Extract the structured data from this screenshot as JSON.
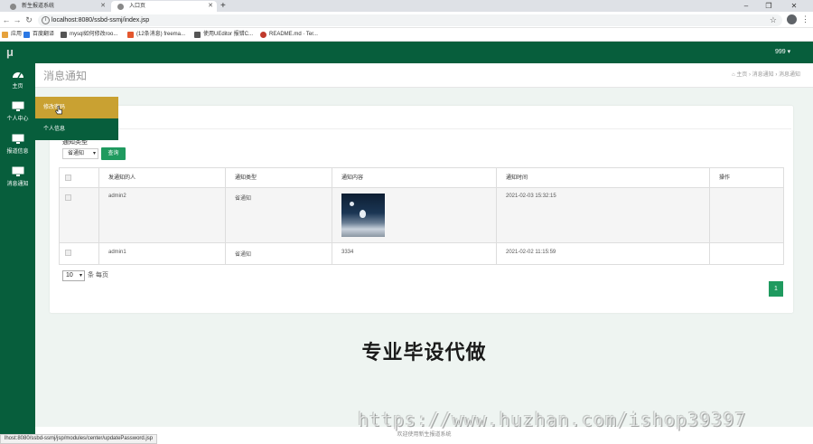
{
  "browser": {
    "tabs": [
      {
        "title": "新生报道系统"
      },
      {
        "title": "入口页"
      }
    ],
    "url": "localhost:8080/ssbd-ssmj/index.jsp",
    "bookmarks": [
      "应用",
      "百度翻译",
      "mysql如何修改roo...",
      "(12条消息) freema...",
      "使用UEditor 报错C...",
      "README.md · Ter..."
    ],
    "status_url": "lhost:8080/ssbd-ssmj/jsp/modules/center/updatePassword.jsp"
  },
  "header": {
    "logo": "μ",
    "user": "999 ▾"
  },
  "sidebar": {
    "items": [
      {
        "label": "主页",
        "icon": "dashboard-icon"
      },
      {
        "label": "个人中心",
        "icon": "monitor-icon"
      },
      {
        "label": "报道信息",
        "icon": "monitor-icon"
      },
      {
        "label": "消息通知",
        "icon": "monitor-icon"
      }
    ],
    "submenu": [
      "修改密码",
      "个人信息"
    ],
    "colors": {
      "bg": "#075e3c",
      "submenu_active": "#c9a132",
      "submenu": "#075e3c"
    }
  },
  "page": {
    "title": "消息通知",
    "breadcrumb": [
      "主页",
      "消息通知",
      "消息通知"
    ]
  },
  "filter": {
    "label": "通知类型",
    "selected": "省通知",
    "button": "查询"
  },
  "table": {
    "headers": [
      "发通知的人",
      "通知类型",
      "通知内容",
      "通知时间",
      "操作"
    ],
    "rows": [
      {
        "sender": "admin2",
        "type": "省通知",
        "content": "[image]",
        "time": "2021-02-03 15:32:15",
        "action": ""
      },
      {
        "sender": "admin1",
        "type": "省通知",
        "content": "3334",
        "time": "2021-02-02 11:15:59",
        "action": ""
      }
    ]
  },
  "pagination": {
    "page_size": "10",
    "page_size_suffix": "条 每页",
    "current_page": "1"
  },
  "overlay": {
    "big_text": "专业毕设代做",
    "url_text": "https://www.huzhan.com/ishop39397"
  },
  "footer": {
    "text": "欢迎使用新生报道系统"
  },
  "accent": "#1f9a5f"
}
